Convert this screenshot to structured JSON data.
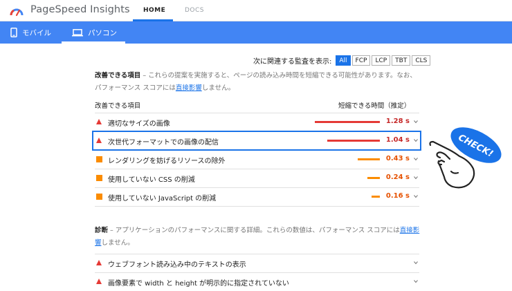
{
  "header": {
    "brand": "PageSpeed Insights",
    "tabs": [
      {
        "label": "HOME",
        "active": true
      },
      {
        "label": "DOCS",
        "active": false
      }
    ]
  },
  "device_tabs": [
    {
      "label": "モバイル",
      "icon": "phone-icon",
      "active": false
    },
    {
      "label": "パソコン",
      "icon": "laptop-icon",
      "active": true
    }
  ],
  "filter": {
    "label": "次に関連する監査を表示:",
    "options": [
      "All",
      "FCP",
      "LCP",
      "TBT",
      "CLS"
    ],
    "selected": "All"
  },
  "opportunities": {
    "title": "改善できる項目",
    "desc_pre": " – これらの提案を実施すると、ページの読み込み時間を短縮できる可能性があります。なお、パフォーマンス スコアには",
    "desc_link": "直接影響",
    "desc_post": "しません。",
    "col_left": "改善できる項目",
    "col_right": "短縮できる時間（推定）",
    "items": [
      {
        "label": "適切なサイズの画像",
        "value": "1.28 s",
        "severity": "fail",
        "fraction": 1.0
      },
      {
        "label": "次世代フォーマットでの画像の配信",
        "value": "1.04 s",
        "severity": "fail",
        "fraction": 0.81
      },
      {
        "label": "レンダリングを妨げるリソースの除外",
        "value": "0.43 s",
        "severity": "average",
        "fraction": 0.34
      },
      {
        "label": "使用していない CSS の削減",
        "value": "0.24 s",
        "severity": "average",
        "fraction": 0.19
      },
      {
        "label": "使用していない JavaScript の削減",
        "value": "0.16 s",
        "severity": "average",
        "fraction": 0.13
      }
    ],
    "highlighted_index": 1
  },
  "diagnostics": {
    "title": "診断",
    "desc_pre": " – アプリケーションのパフォーマンスに関する詳細。これらの数値は、パフォーマンス スコアには",
    "desc_link": "直接影響",
    "desc_post": "しません。",
    "items": [
      {
        "label": "ウェブフォント読み込み中のテキストの表示",
        "severity": "fail"
      },
      {
        "label": "画像要素で width と height が明示的に指定されていない",
        "severity": "fail"
      }
    ]
  },
  "mascot": {
    "text": "CHECK!"
  },
  "colors": {
    "accent": "#1a73e8",
    "device_bar": "#4285f4",
    "fail": "#e53935",
    "average": "#fb8c00"
  }
}
